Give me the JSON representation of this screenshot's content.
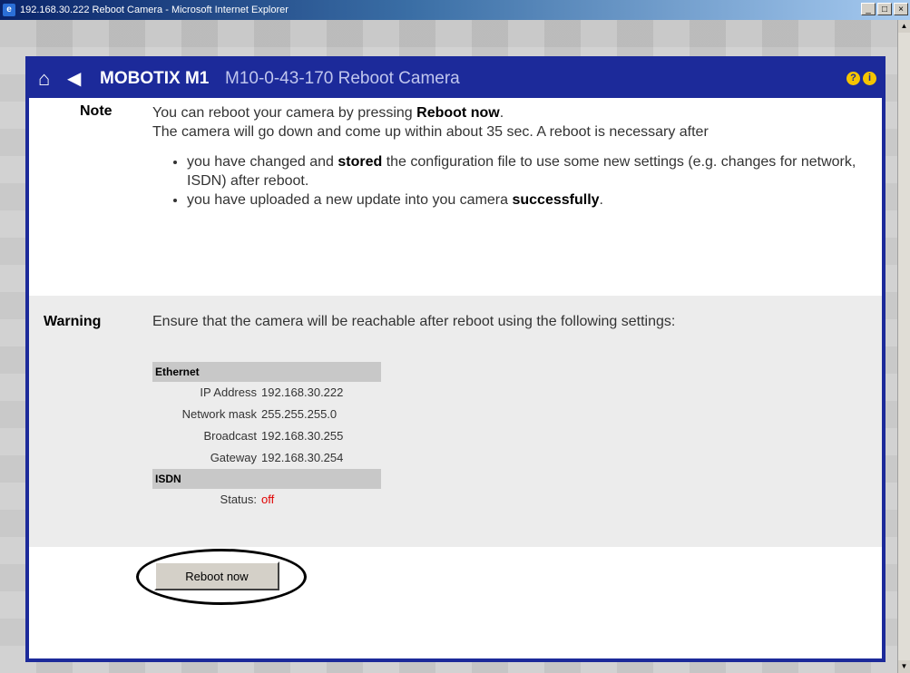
{
  "window": {
    "title": "192.168.30.222 Reboot Camera - Microsoft Internet Explorer",
    "icon": "ie-icon",
    "controls": [
      "_",
      "□",
      "×"
    ]
  },
  "header": {
    "brand": "MOBOTIX M1",
    "subtitle": "M10-0-43-170 Reboot Camera",
    "icons": [
      "home-icon",
      "back-arrow-icon",
      "help-icon",
      "info-icon"
    ],
    "help_glyph": "?",
    "info_glyph": "i"
  },
  "note": {
    "label": "Note",
    "line1_prefix": "You can reboot your camera by pressing ",
    "line1_bold": "Reboot now",
    "line1_suffix": ".",
    "line2": "The camera will go down and come up within about 35 sec. A reboot is necessary after",
    "bullet1_prefix": "you have changed and ",
    "bullet1_bold": "stored",
    "bullet1_suffix": " the configuration file to use some new settings (e.g. changes for network, ISDN) after reboot.",
    "bullet2_prefix": "you have uploaded a new update into you camera ",
    "bullet2_bold": "successfully",
    "bullet2_suffix": "."
  },
  "warning": {
    "label": "Warning",
    "text": "Ensure that the camera will be reachable after reboot using the following settings:",
    "ethernet_header": "Ethernet",
    "ethernet_rows": [
      {
        "key": "IP Address",
        "value": "192.168.30.222"
      },
      {
        "key": "Network mask",
        "value": "255.255.255.0"
      },
      {
        "key": "Broadcast",
        "value": "192.168.30.255"
      },
      {
        "key": "Gateway",
        "value": "192.168.30.254"
      }
    ],
    "isdn_header": "ISDN",
    "isdn_status_key": "Status:",
    "isdn_status_value": "off",
    "status_color": "#e00000"
  },
  "actions": {
    "reboot_label": "Reboot now"
  },
  "colors": {
    "accent": "#1c2a9a",
    "warning_bg": "#ececec"
  }
}
